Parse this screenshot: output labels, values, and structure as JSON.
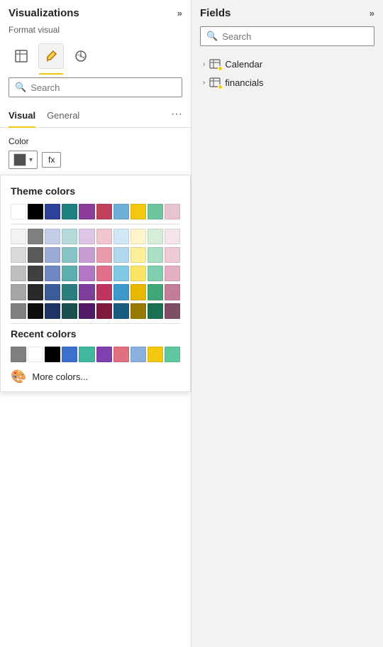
{
  "left_panel": {
    "title": "Visualizations",
    "format_label": "Format visual",
    "search_placeholder": "Search",
    "tabs": [
      "Visual",
      "General"
    ],
    "active_tab": "Visual",
    "more_label": "···",
    "color_label": "Color",
    "fx_label": "fx",
    "color_picker": {
      "theme_colors_label": "Theme colors",
      "recent_colors_label": "Recent colors",
      "more_colors_label": "More colors...",
      "theme_rows": [
        [
          "#ffffff",
          "#000000",
          "#2e4099",
          "#1e8080",
          "#8c3d99",
          "#c0415a",
          "#6baed6",
          "#f2c811",
          "#6ec6a0",
          "#e8c4d0"
        ],
        [
          "#f2f2f2",
          "#7f7f7f",
          "#c5cce8",
          "#b3d9d9",
          "#dcc5e5",
          "#f0c5ce",
          "#d0e8f5",
          "#fef5cc",
          "#d5eed9",
          "#f5e5ea"
        ],
        [
          "#d9d9d9",
          "#595959",
          "#9aaad4",
          "#88c4c4",
          "#c79ed4",
          "#e89aaa",
          "#b0d8ee",
          "#fdef99",
          "#aadec5",
          "#eecad4"
        ],
        [
          "#bfbfbf",
          "#404040",
          "#7088bf",
          "#5daeae",
          "#b277c3",
          "#e0708a",
          "#7fc8e6",
          "#fce566",
          "#7fcfae",
          "#e4afc0"
        ],
        [
          "#a6a6a6",
          "#292929",
          "#3a5c99",
          "#2d7d7d",
          "#7d3f99",
          "#c03460",
          "#3d99cc",
          "#e6b800",
          "#40a878",
          "#c47d99"
        ],
        [
          "#808080",
          "#0d0d0d",
          "#1e3366",
          "#1a4f4f",
          "#521a66",
          "#801a3d",
          "#1a5c80",
          "#997a00",
          "#1a7050",
          "#804d66"
        ]
      ],
      "recent_colors": [
        "#808080",
        "#ffffff",
        "#000000",
        "#3d6fcc",
        "#40b8a0",
        "#8040b0",
        "#e07080",
        "#8ab0e0",
        "#f2c811",
        "#60c8a0"
      ]
    }
  },
  "right_panel": {
    "title": "Fields",
    "search_placeholder": "Search",
    "fields": [
      {
        "name": "Calendar",
        "has_badge": true
      },
      {
        "name": "financials",
        "has_badge": true
      }
    ]
  },
  "icons": {
    "expand": "»",
    "search": "🔍",
    "chevron_down": "▾",
    "chevron_right": "›",
    "palette": "🎨"
  }
}
